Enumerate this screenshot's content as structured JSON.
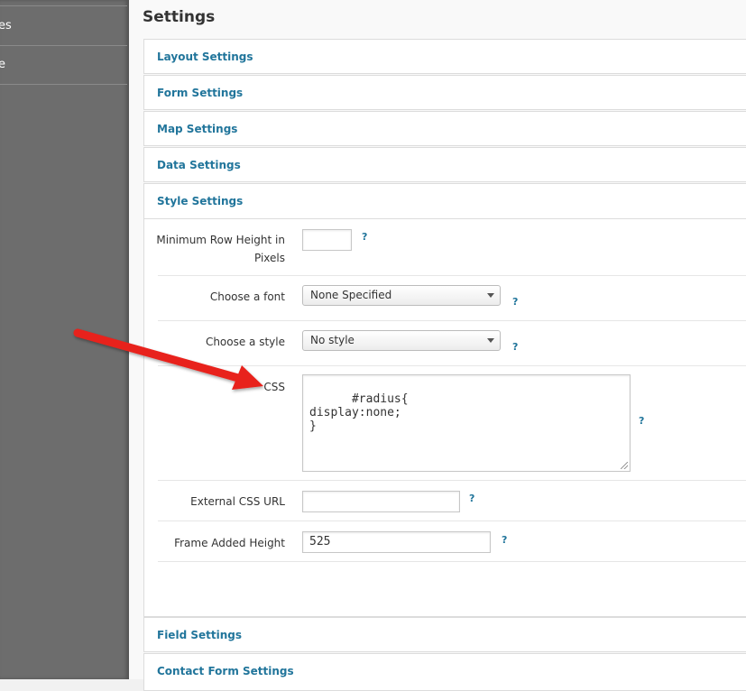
{
  "sidebar": {
    "items": [
      {
        "label": "es"
      },
      {
        "label": "e"
      }
    ]
  },
  "page": {
    "title": "Settings"
  },
  "panels": {
    "layout": "Layout Settings",
    "form": "Form Settings",
    "map": "Map Settings",
    "data": "Data Settings",
    "style": "Style Settings",
    "field": "Field Settings",
    "contact": "Contact Form Settings"
  },
  "style_settings": {
    "min_row_height": {
      "label": "Minimum Row Height in Pixels",
      "value": ""
    },
    "font": {
      "label": "Choose a font",
      "selected": "None Specified"
    },
    "style": {
      "label": "Choose a style",
      "selected": "No style"
    },
    "css": {
      "label": "CSS",
      "value": "#radius{\ndisplay:none;\n}"
    },
    "external_css": {
      "label": "External CSS URL",
      "value": ""
    },
    "frame_height": {
      "label": "Frame Added Height",
      "value": "525"
    },
    "help_text": "?"
  },
  "colors": {
    "link": "#21759b",
    "sidebar_bg": "#6d6d6d",
    "arrow": "#e8201a"
  },
  "annotation": {
    "icon": "red-arrow-icon"
  }
}
